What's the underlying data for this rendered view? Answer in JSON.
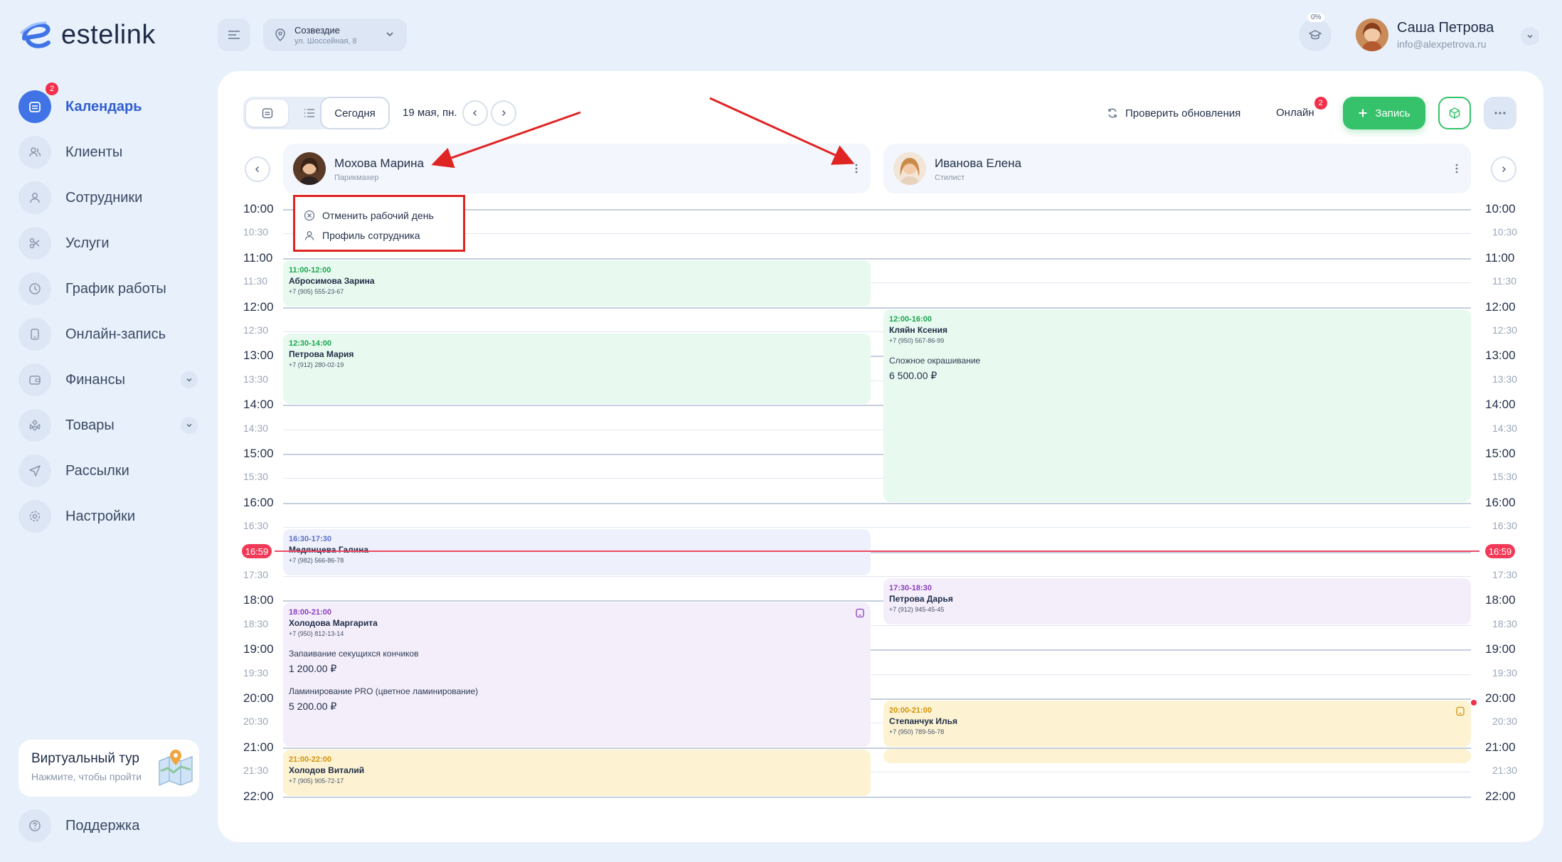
{
  "app": {
    "name": "estelink"
  },
  "sidebar": {
    "items": [
      {
        "label": "Календарь",
        "icon": "calendar-icon",
        "active": true,
        "badge": "2"
      },
      {
        "label": "Клиенты",
        "icon": "clients-icon"
      },
      {
        "label": "Сотрудники",
        "icon": "user-icon"
      },
      {
        "label": "Услуги",
        "icon": "scissors-icon"
      },
      {
        "label": "График работы",
        "icon": "clock-icon"
      },
      {
        "label": "Онлайн-запись",
        "icon": "phone-icon"
      },
      {
        "label": "Финансы",
        "icon": "wallet-icon",
        "expandable": true
      },
      {
        "label": "Товары",
        "icon": "box-icon",
        "expandable": true
      },
      {
        "label": "Рассылки",
        "icon": "send-icon"
      },
      {
        "label": "Настройки",
        "icon": "gear-icon"
      }
    ],
    "tour": {
      "title": "Виртуальный тур",
      "subtitle": "Нажмите, чтобы пройти"
    },
    "support": {
      "label": "Поддержка"
    }
  },
  "topbar": {
    "branch": {
      "name": "Созвездие",
      "address": "ул. Шоссейная, 8"
    },
    "progress": "0%",
    "user": {
      "name": "Саша Петрова",
      "email": "info@alexpetrova.ru"
    }
  },
  "toolbar": {
    "today": "Сегодня",
    "date": "19 мая, пн.",
    "check_updates": "Проверить обновления",
    "online": "Онлайн",
    "online_badge": "2",
    "new_record": "Запись"
  },
  "staff": [
    {
      "name": "Мохова Марина",
      "role": "Парикмахер"
    },
    {
      "name": "Иванова Елена",
      "role": "Стилист"
    }
  ],
  "dropdown": {
    "items": [
      "Отменить рабочий день",
      "Профиль сотрудника"
    ]
  },
  "times": [
    "10:00",
    "10:30",
    "11:00",
    "11:30",
    "12:00",
    "12:30",
    "13:00",
    "13:30",
    "14:00",
    "14:30",
    "15:00",
    "15:30",
    "16:00",
    "16:30",
    "17:00",
    "17:30",
    "18:00",
    "18:30",
    "19:00",
    "19:30",
    "20:00",
    "20:30",
    "21:00",
    "21:30",
    "22:00"
  ],
  "now": "16:59",
  "events": [
    {
      "col": 0,
      "color": "green",
      "time": "11:00-12:00",
      "client": "Абросимова Зарина",
      "phone": "+7 (905) 555-23-67"
    },
    {
      "col": 0,
      "color": "green",
      "time": "12:30-14:00",
      "client": "Петрова Мария",
      "phone": "+7 (912) 280-02-19"
    },
    {
      "col": 0,
      "color": "blue",
      "time": "16:30-17:30",
      "client": "Медянцева Галина",
      "phone": "+7 (982) 566-86-78"
    },
    {
      "col": 0,
      "color": "purple",
      "time": "18:00-21:00",
      "client": "Холодова Маргарита",
      "phone": "+7 (950) 812-13-14",
      "services": [
        {
          "name": "Запаивание секущихся кончиков",
          "price": "1 200.00 ₽"
        },
        {
          "name": "Ламинирование PRO (цветное ламинирование)",
          "price": "5 200.00 ₽"
        }
      ]
    },
    {
      "col": 0,
      "color": "yellow",
      "time": "21:00-22:00",
      "client": "Холодов Виталий",
      "phone": "+7 (905) 905-72-17"
    },
    {
      "col": 1,
      "color": "green",
      "time": "12:00-16:00",
      "client": "Кляйн Ксения",
      "phone": "+7 (950) 567-86-99",
      "services": [
        {
          "name": "Сложное окрашивание",
          "price": "6 500.00 ₽"
        }
      ]
    },
    {
      "col": 1,
      "color": "purple",
      "time": "17:30-18:30",
      "client": "Петрова Дарья",
      "phone": "+7 (912) 945-45-45"
    },
    {
      "col": 1,
      "color": "yellow",
      "time": "20:00-21:00",
      "client": "Степанчук Илья",
      "phone": "+7 (950) 789-56-78"
    }
  ],
  "colors": {
    "accent": "#3f73e6",
    "green": "#36c26b",
    "red": "#f2304b"
  }
}
